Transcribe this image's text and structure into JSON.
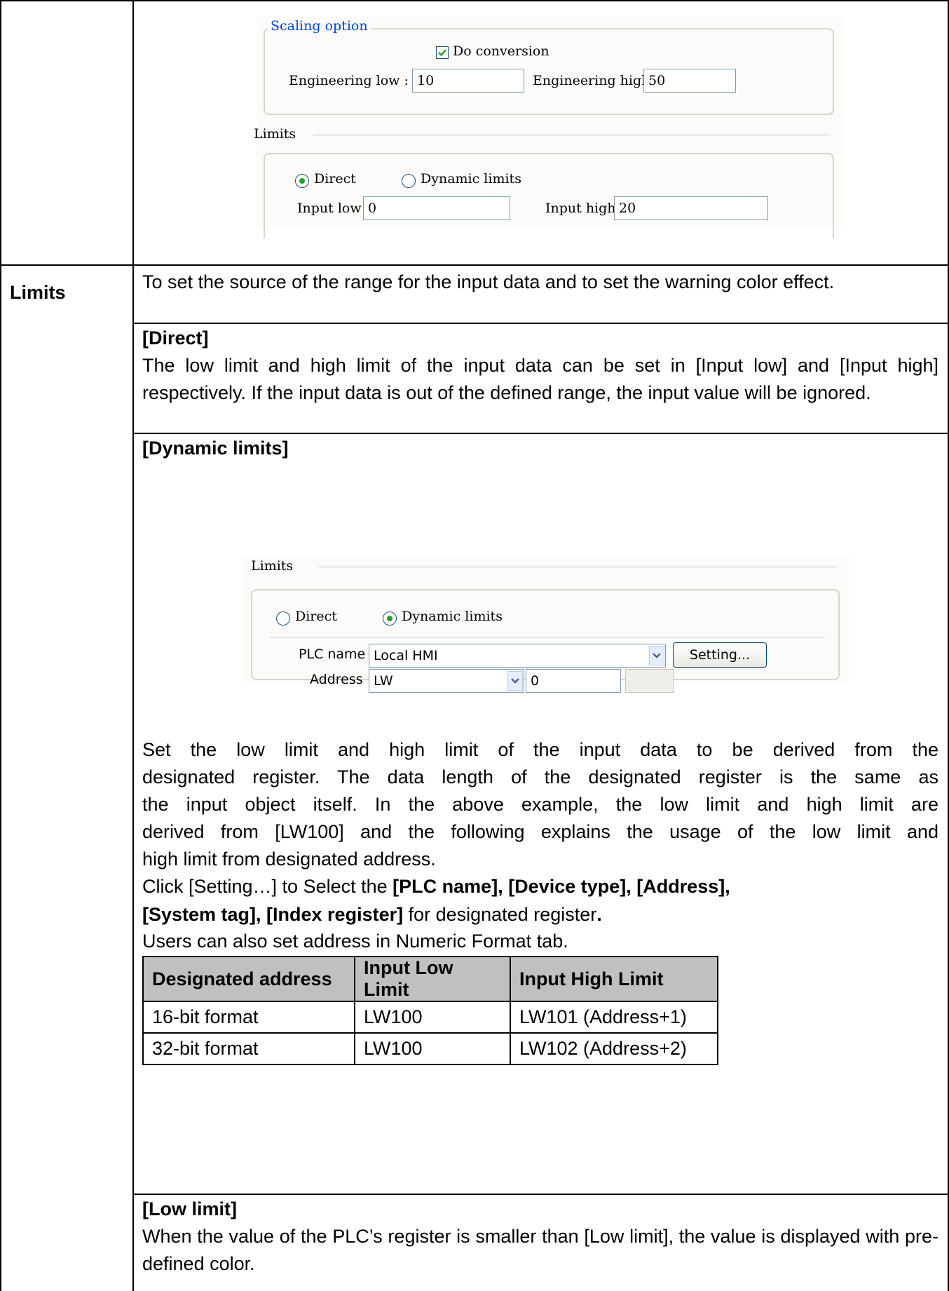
{
  "scaling_dialog": {
    "group_title": "Scaling option",
    "do_conversion": {
      "label": "Do conversion",
      "checked": true
    },
    "eng_low_label": "Engineering low :",
    "eng_low_value": "10",
    "eng_high_label": "Engineering high :",
    "eng_high_value": "50",
    "limits_title": "Limits",
    "radio_direct": "Direct",
    "radio_dynamic": "Dynamic limits",
    "selected": "Direct",
    "input_low_label": "Input low :",
    "input_low_value": "0",
    "input_high_label": "Input high :",
    "input_high_value": "20"
  },
  "row_label": "Limits",
  "intro": "To set the source of the range for the input data and to set the warning color effect.",
  "direct": {
    "heading": "[Direct]",
    "body": "The low limit and high limit of the input data can be set in [Input low] and [Input high] respectively. If the input data is out of the defined range, the input value will be ignored."
  },
  "dynamic": {
    "heading": "[Dynamic limits]",
    "dialog": {
      "limits_title": "Limits",
      "radio_direct": "Direct",
      "radio_dynamic": "Dynamic limits",
      "selected": "Dynamic limits",
      "plc_label": "PLC name :",
      "plc_value": "Local HMI",
      "setting_button": "Setting...",
      "address_label": "Address :",
      "address_type": "LW",
      "address_value": "0"
    },
    "para_lines": [
      "Set the low limit and high limit of the input data to be derived from the",
      "designated register. The data length of the designated register is the same as",
      "the input object itself. In the above example, the low limit and high limit are",
      "derived from [LW100] and the following explains the usage of the low limit and",
      "high limit from designated address."
    ],
    "click_prefix": "Click [Setting…] to Select the ",
    "click_bold1": "[PLC name], [Device type], [Address],",
    "click_bold2": "[System tag], [Index register]",
    "click_suffix": " for designated register",
    "click_end": ".",
    "users_line": "Users can also set address in Numeric Format tab.",
    "table": {
      "headers": [
        "Designated address",
        "Input Low Limit",
        "Input High Limit"
      ],
      "rows": [
        [
          "16-bit format",
          "LW100",
          "LW101 (Address+1)"
        ],
        [
          "32-bit format",
          "LW100",
          "LW102 (Address+2)"
        ]
      ]
    }
  },
  "low_limit": {
    "heading": "[Low limit]",
    "body": "When the value of the PLC’s register is smaller than [Low limit], the value is displayed with pre-defined color."
  }
}
